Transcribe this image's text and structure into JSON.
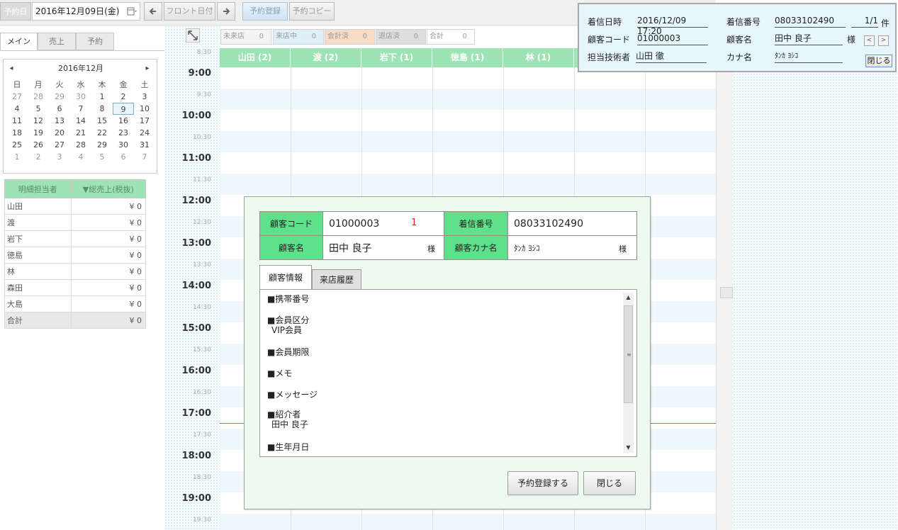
{
  "topbar": {
    "date_label": "予約日",
    "date_value": "2016年12月09日(金)",
    "front_date_label": "フロント日付",
    "reserve_register_label": "予約登録",
    "reserve_copy_label": "予約コピー"
  },
  "left_tabs": [
    "メイン",
    "売上",
    "予約"
  ],
  "calendar": {
    "month_title": "2016年12月",
    "weekdays": [
      "日",
      "月",
      "火",
      "水",
      "木",
      "金",
      "土"
    ],
    "days": [
      "27",
      "28",
      "29",
      "30",
      "1",
      "2",
      "3",
      "4",
      "5",
      "6",
      "7",
      "8",
      "9",
      "10",
      "11",
      "12",
      "13",
      "14",
      "15",
      "16",
      "17",
      "18",
      "19",
      "20",
      "21",
      "22",
      "23",
      "24",
      "25",
      "26",
      "27",
      "28",
      "29",
      "30",
      "31",
      "1",
      "2",
      "3",
      "4",
      "5",
      "6",
      "7"
    ],
    "selected_day": "9"
  },
  "staff_sales": {
    "headers": [
      "明細担当者",
      "▼総売上(税抜)"
    ],
    "rows": [
      {
        "name": "山田",
        "amount": "¥ 0"
      },
      {
        "name": "渡",
        "amount": "¥ 0"
      },
      {
        "name": "岩下",
        "amount": "¥ 0"
      },
      {
        "name": "徳島",
        "amount": "¥ 0"
      },
      {
        "name": "林",
        "amount": "¥ 0"
      },
      {
        "name": "森田",
        "amount": "¥ 0"
      },
      {
        "name": "大島",
        "amount": "¥ 0"
      }
    ],
    "total": {
      "name": "合計",
      "amount": "¥ 0"
    }
  },
  "status_counts": [
    {
      "label": "未来店",
      "count": "0"
    },
    {
      "label": "来店中",
      "count": "0"
    },
    {
      "label": "会計済",
      "count": "0"
    },
    {
      "label": "退店済",
      "count": "0"
    },
    {
      "label": "合計",
      "count": "0"
    }
  ],
  "schedule": {
    "staff_columns": [
      "山田 (2)",
      "渡 (2)",
      "岩下 (1)",
      "徳島 (1)",
      "林 (1)"
    ],
    "times": [
      "8:30",
      "9:00",
      "9:30",
      "10:00",
      "10:30",
      "11:00",
      "11:30",
      "12:00",
      "12:30",
      "13:00",
      "13:30",
      "14:00",
      "14:30",
      "15:00",
      "15:30",
      "16:00",
      "16:30",
      "17:00",
      "17:30",
      "18:00",
      "18:30",
      "19:00",
      "19:30"
    ]
  },
  "incoming_call": {
    "datetime_label": "着信日時",
    "datetime_value": "2016/12/09 17:20",
    "number_label": "着信番号",
    "number_value": "08033102490",
    "page_value": "1/1",
    "page_unit": "件",
    "customer_code_label": "顧客コード",
    "customer_code_value": "01000003",
    "customer_name_label": "顧客名",
    "customer_name_value": "田中 良子",
    "honorific": "様",
    "staff_label": "担当技術者",
    "staff_value": "山田 徹",
    "kana_label": "カナ名",
    "kana_value": "ﾀﾝｶ ﾖｼｺ",
    "close_label": "閉じる"
  },
  "customer_dialog": {
    "code_label": "顧客コード",
    "code_value": "01000003",
    "code_count": "1",
    "phone_label": "着信番号",
    "phone_value": "08033102490",
    "name_label": "顧客名",
    "name_value": "田中 良子",
    "honorific": "様",
    "kana_label": "顧客カナ名",
    "kana_value": "ﾀﾝｶ ﾖｼｺ",
    "tabs": [
      "顧客情報",
      "来店履歴"
    ],
    "info_sections": [
      {
        "title": "■携帯番号",
        "value": ""
      },
      {
        "title": "■会員区分",
        "value": "VIP会員"
      },
      {
        "title": "■会員期限",
        "value": ""
      },
      {
        "title": "■メモ",
        "value": ""
      },
      {
        "title": "■メッセージ",
        "value": ""
      },
      {
        "title": "■紹介者",
        "value": "田中 良子"
      },
      {
        "title": "■生年月日",
        "value": ""
      }
    ],
    "register_button": "予約登録する",
    "close_button": "閉じる"
  },
  "colors": {
    "header_green": "#9ee3b3",
    "dialog_label_green": "#5fe08a",
    "incoming_bg": "#e7f6fb",
    "code_count_red": "#e02020"
  }
}
